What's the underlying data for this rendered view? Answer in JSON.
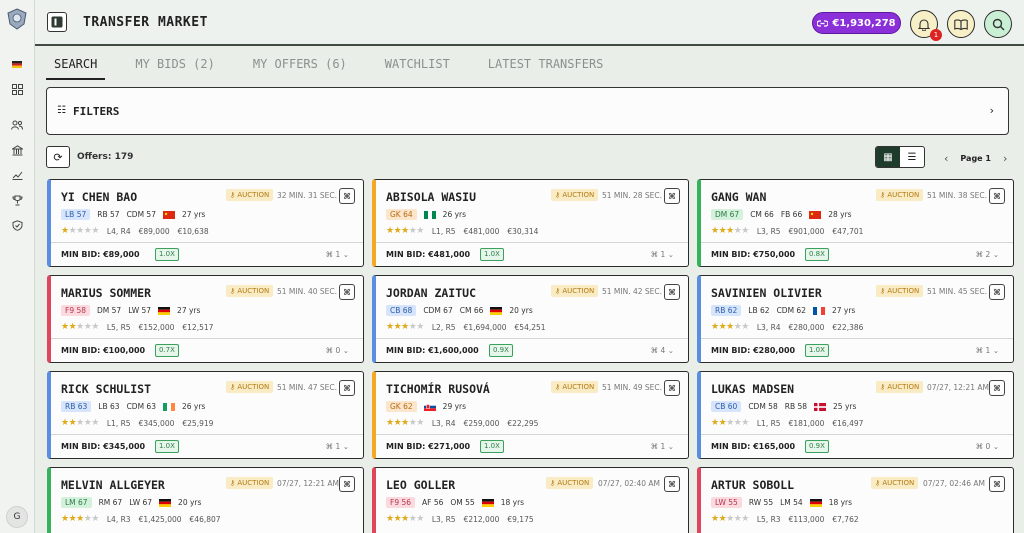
{
  "header": {
    "title": "TRANSFER MARKET",
    "balance": "€1,930,278",
    "notifications": "1"
  },
  "tabs": [
    {
      "label": "SEARCH"
    },
    {
      "label": "MY BIDS (2)"
    },
    {
      "label": "MY OFFERS (6)"
    },
    {
      "label": "WATCHLIST"
    },
    {
      "label": "LATEST TRANSFERS"
    }
  ],
  "filters": {
    "label": "FILTERS"
  },
  "toolbar": {
    "offers": "Offers: 179",
    "page": "Page 1"
  },
  "user": {
    "initial": "G"
  },
  "accents": {
    "orange": "#f3a826",
    "blue": "#5a8ee0",
    "green": "#35b25a",
    "red": "#e0455e",
    "brand": "#8b2fd9"
  },
  "cards": [
    {
      "name": "YI CHEN BAO",
      "auction": "AUCTION",
      "time": "32 MIN. 31 SEC.",
      "pos": "LB 57",
      "pos2": "RB 57",
      "pos3": "CDM 57",
      "flag": "china",
      "age": "27 yrs",
      "stars": 1,
      "inj": "L4, R4",
      "value": "€89,000",
      "wage": "€10,638",
      "min_bid": "MIN BID: €89,000",
      "mult": "1.0X",
      "watchers": "1"
    },
    {
      "name": "ABISOLA WASIU",
      "auction": "AUCTION",
      "time": "51 MIN. 28 SEC.",
      "pos": "GK 64",
      "pos2": "",
      "pos3": "",
      "flag": "nigeria",
      "age": "26 yrs",
      "stars": 3,
      "inj": "L1, R5",
      "value": "€481,000",
      "wage": "€30,314",
      "min_bid": "MIN BID: €481,000",
      "mult": "1.0X",
      "watchers": "1"
    },
    {
      "name": "GANG WAN",
      "auction": "AUCTION",
      "time": "51 MIN. 38 SEC.",
      "pos": "DM 67",
      "pos2": "CM 66",
      "pos3": "FB 66",
      "flag": "china",
      "age": "28 yrs",
      "stars": 3,
      "inj": "L3, R5",
      "value": "€901,000",
      "wage": "€47,701",
      "min_bid": "MIN BID: €750,000",
      "mult": "0.8X",
      "watchers": "2"
    },
    {
      "name": "MARIUS SOMMER",
      "auction": "AUCTION",
      "time": "51 MIN. 40 SEC.",
      "pos": "F9 58",
      "pos2": "DM 57",
      "pos3": "LW 57",
      "flag": "germany",
      "age": "27 yrs",
      "stars": 2,
      "inj": "L5, R5",
      "value": "€152,000",
      "wage": "€12,517",
      "min_bid": "MIN BID: €100,000",
      "mult": "0.7X",
      "watchers": "0"
    },
    {
      "name": "JORDAN ZAITUC",
      "auction": "AUCTION",
      "time": "51 MIN. 42 SEC.",
      "pos": "CB 68",
      "pos2": "CDM 67",
      "pos3": "CM 66",
      "flag": "germany",
      "age": "20 yrs",
      "stars": 3,
      "inj": "L2, R5",
      "value": "€1,694,000",
      "wage": "€54,251",
      "min_bid": "MIN BID: €1,600,000",
      "mult": "0.9X",
      "watchers": "4"
    },
    {
      "name": "SAVINIEN OLIVIER",
      "auction": "AUCTION",
      "time": "51 MIN. 45 SEC.",
      "pos": "RB 62",
      "pos2": "LB 62",
      "pos3": "CDM 62",
      "flag": "france",
      "age": "27 yrs",
      "stars": 3,
      "inj": "L3, R4",
      "value": "€280,000",
      "wage": "€22,386",
      "min_bid": "MIN BID: €280,000",
      "mult": "1.0X",
      "watchers": "1"
    },
    {
      "name": "RICK SCHULIST",
      "auction": "AUCTION",
      "time": "51 MIN. 47 SEC.",
      "pos": "RB 63",
      "pos2": "LB 63",
      "pos3": "CDM 63",
      "flag": "ireland",
      "age": "26 yrs",
      "stars": 2,
      "inj": "L1, R5",
      "value": "€345,000",
      "wage": "€25,919",
      "min_bid": "MIN BID: €345,000",
      "mult": "1.0X",
      "watchers": "1"
    },
    {
      "name": "TICHOMÍR RUSOVÁ",
      "auction": "AUCTION",
      "time": "51 MIN. 49 SEC.",
      "pos": "GK 62",
      "pos2": "",
      "pos3": "",
      "flag": "slovakia",
      "age": "29 yrs",
      "stars": 3,
      "inj": "L3, R4",
      "value": "€259,000",
      "wage": "€22,295",
      "min_bid": "MIN BID: €271,000",
      "mult": "1.0X",
      "watchers": "1"
    },
    {
      "name": "LUKAS MADSEN",
      "auction": "AUCTION",
      "time": "07/27, 12:21 AM",
      "pos": "CB 60",
      "pos2": "CDM 58",
      "pos3": "RB 58",
      "flag": "denmark",
      "age": "25 yrs",
      "stars": 2,
      "inj": "L1, R5",
      "value": "€181,000",
      "wage": "€16,497",
      "min_bid": "MIN BID: €165,000",
      "mult": "0.9X",
      "watchers": "0"
    },
    {
      "name": "MELVIN ALLGEYER",
      "auction": "AUCTION",
      "time": "07/27, 12:21 AM",
      "pos": "LM 67",
      "pos2": "RM 67",
      "pos3": "LW 67",
      "flag": "germany",
      "age": "20 yrs",
      "stars": 3,
      "inj": "L4, R3",
      "value": "€1,425,000",
      "wage": "€46,807",
      "min_bid": "",
      "mult": "",
      "watchers": ""
    },
    {
      "name": "LEO GOLLER",
      "auction": "AUCTION",
      "time": "07/27, 02:40 AM",
      "pos": "F9 56",
      "pos2": "AF 56",
      "pos3": "OM 55",
      "flag": "germany",
      "age": "18 yrs",
      "stars": 3,
      "inj": "L3, R5",
      "value": "€212,000",
      "wage": "€9,175",
      "min_bid": "",
      "mult": "",
      "watchers": ""
    },
    {
      "name": "ARTUR SOBOLL",
      "auction": "AUCTION",
      "time": "07/27, 02:46 AM",
      "pos": "LW 55",
      "pos2": "RW 55",
      "pos3": "LM 54",
      "flag": "germany",
      "age": "18 yrs",
      "stars": 2,
      "inj": "L5, R3",
      "value": "€113,000",
      "wage": "€7,762",
      "min_bid": "",
      "mult": "",
      "watchers": ""
    }
  ]
}
